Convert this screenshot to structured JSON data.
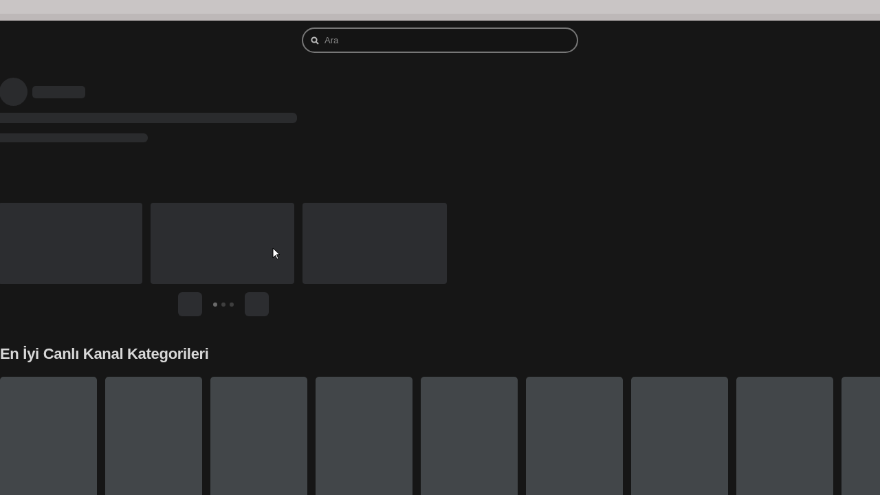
{
  "search": {
    "placeholder": "Ara"
  },
  "carousel_dots": [
    {
      "selected": true
    },
    {
      "selected": false
    },
    {
      "selected": false
    }
  ],
  "section": {
    "title": "En İyi Canlı Kanal Kategorileri"
  }
}
